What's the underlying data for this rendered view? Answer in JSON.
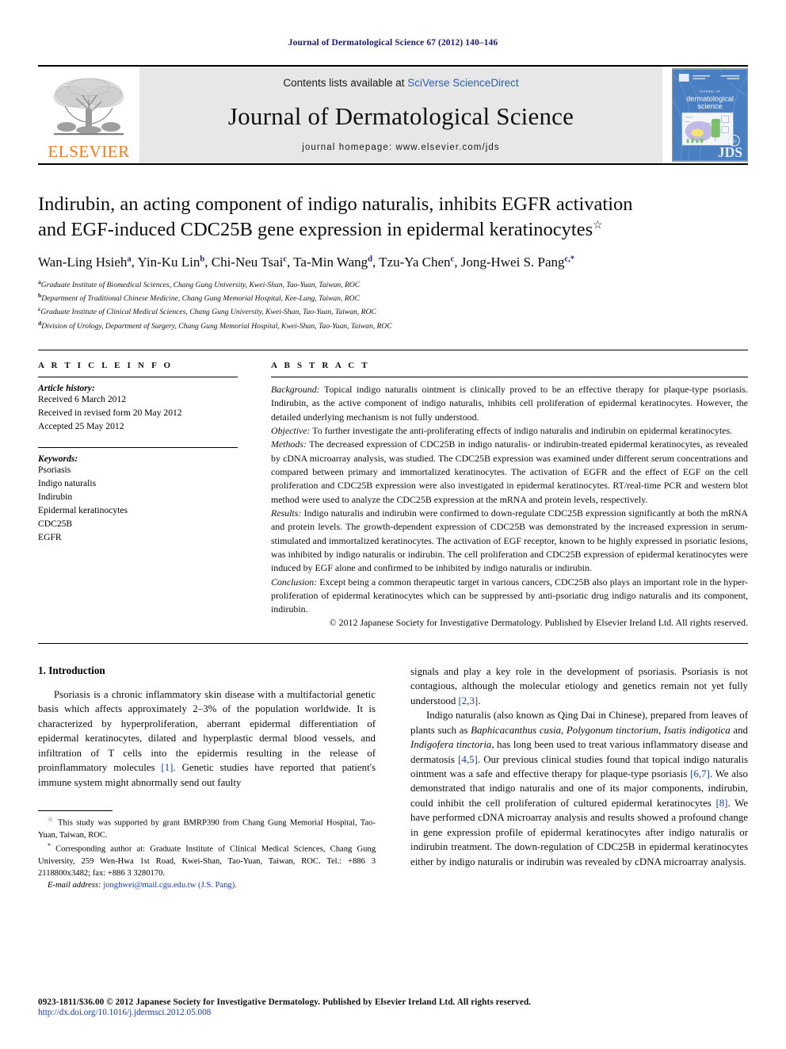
{
  "running_head": "Journal of Dermatological Science 67 (2012) 140–146",
  "masthead": {
    "publisher_name": "ELSEVIER",
    "contents_prefix": "Contents lists available at ",
    "contents_link": "SciVerse ScienceDirect",
    "journal_name": "Journal of Dermatological Science",
    "homepage": "journal homepage: www.elsevier.com/jds",
    "cover_title_small": "JOURNAL OF",
    "cover_title_1": "dermatological",
    "cover_title_2": "science",
    "cover_logo": "JDS",
    "accent_orange": "#F47B20",
    "link_blue": "#2b5fb5",
    "cover_blue": "#4a7fc1"
  },
  "title": {
    "line1": "Indirubin, an acting component of indigo naturalis, inhibits EGFR activation",
    "line2": "and EGF-induced CDC25B gene expression in epidermal keratinocytes",
    "title_marker": "☆"
  },
  "authors": [
    {
      "name": "Wan-Ling Hsieh",
      "sup": "a"
    },
    {
      "name": "Yin-Ku Lin",
      "sup": "b"
    },
    {
      "name": "Chi-Neu Tsai",
      "sup": "c"
    },
    {
      "name": "Ta-Min Wang",
      "sup": "d"
    },
    {
      "name": "Tzu-Ya Chen",
      "sup": "c"
    },
    {
      "name": "Jong-Hwei S. Pang",
      "sup": "c,*"
    }
  ],
  "affiliations": [
    {
      "marker": "a",
      "text": "Graduate Institute of Biomedical Sciences, Chang Gung University, Kwei-Shan, Tao-Yuan, Taiwan, ROC"
    },
    {
      "marker": "b",
      "text": "Department of Traditional Chinese Medicine, Chang Gung Memorial Hospital, Kee-Lung, Taiwan, ROC"
    },
    {
      "marker": "c",
      "text": "Graduate Institute of Clinical Medical Sciences, Chang Gung University, Kwei-Shan, Tao-Yuan, Taiwan, ROC"
    },
    {
      "marker": "d",
      "text": "Division of Urology, Department of Surgery, Chang Gung Memorial Hospital, Kwei-Shan, Tao-Yuan, Taiwan, ROC"
    }
  ],
  "article_info": {
    "heading": "A R T I C L E  I N F O",
    "history_label": "Article history:",
    "history": [
      "Received 6 March 2012",
      "Received in revised form 20 May 2012",
      "Accepted 25 May 2012"
    ],
    "keywords_label": "Keywords:",
    "keywords": [
      "Psoriasis",
      "Indigo naturalis",
      "Indirubin",
      "Epidermal keratinocytes",
      "CDC25B",
      "EGFR"
    ]
  },
  "abstract": {
    "heading": "A B S T R A C T",
    "sections": [
      {
        "label": "Background:",
        "text": " Topical indigo naturalis ointment is clinically proved to be an effective therapy for plaque-type psoriasis. Indirubin, as the active component of indigo naturalis, inhibits cell proliferation of epidermal keratinocytes. However, the detailed underlying mechanism is not fully understood."
      },
      {
        "label": "Objective:",
        "text": " To further investigate the anti-proliferating effects of indigo naturalis and indirubin on epidermal keratinocytes."
      },
      {
        "label": "Methods:",
        "text": " The decreased expression of CDC25B in indigo naturalis- or indirubin-treated epidermal keratinocytes, as revealed by cDNA microarray analysis, was studied. The CDC25B expression was examined under different serum concentrations and compared between primary and immortalized keratinocytes. The activation of EGFR and the effect of EGF on the cell proliferation and CDC25B expression were also investigated in epidermal keratinocytes. RT/real-time PCR and western blot method were used to analyze the CDC25B expression at the mRNA and protein levels, respectively."
      },
      {
        "label": "Results:",
        "text": " Indigo naturalis and indirubin were confirmed to down-regulate CDC25B expression significantly at both the mRNA and protein levels. The growth-dependent expression of CDC25B was demonstrated by the increased expression in serum-stimulated and immortalized keratinocytes. The activation of EGF receptor, known to be highly expressed in psoriatic lesions, was inhibited by indigo naturalis or indirubin. The cell proliferation and CDC25B expression of epidermal keratinocytes were induced by EGF alone and confirmed to be inhibited by indigo naturalis or indirubin."
      },
      {
        "label": "Conclusion:",
        "text": " Except being a common therapeutic target in various cancers, CDC25B also plays an important role in the hyper-proliferation of epidermal keratinocytes which can be suppressed by anti-psoriatic drug indigo naturalis and its component, indirubin."
      }
    ],
    "copyright": "© 2012 Japanese Society for Investigative Dermatology. Published by Elsevier Ireland Ltd. All rights reserved."
  },
  "introduction": {
    "heading": "1. Introduction",
    "left_paragraph": "Psoriasis is a chronic inflammatory skin disease with a multifactorial genetic basis which affects approximately 2–3% of the population worldwide. It is characterized by hyperproliferation, aberrant epidermal differentiation of epidermal keratinocytes, dilated and hyperplastic dermal blood vessels, and infiltration of T cells into the epidermis resulting in the release of proinflammatory molecules [1]. Genetic studies have reported that patient's immune system might abnormally send out faulty",
    "right_paragraph_1": "signals and play a key role in the development of psoriasis. Psoriasis is not contagious, although the molecular etiology and genetics remain not yet fully understood [2,3].",
    "right_paragraph_2": "Indigo naturalis (also known as Qing Dai in Chinese), prepared from leaves of plants such as Baphicacanthus cusia, Polygonum tinctorium, Isatis indigotica and Indigofera tinctoria, has long been used to treat various inflammatory disease and dermatosis [4,5]. Our previous clinical studies found that topical indigo naturalis ointment was a safe and effective therapy for plaque-type psoriasis [6,7]. We also demonstrated that indigo naturalis and one of its major components, indirubin, could inhibit the cell proliferation of cultured epidermal keratinocytes [8]. We have performed cDNA microarray analysis and results showed a profound change in gene expression profile of epidermal keratinocytes after indigo naturalis or indirubin treatment. The down-regulation of CDC25B in epidermal keratinocytes either by indigo naturalis or indirubin was revealed by cDNA microarray analysis."
  },
  "footnotes": {
    "grant_marker": "☆",
    "grant": " This study was supported by grant BMRP390 from Chang Gung Memorial Hospital, Tao-Yuan, Taiwan, ROC.",
    "corresponding_marker": "*",
    "corresponding": " Corresponding author at: Graduate Institute of Clinical Medical Sciences, Chang Gung University, 259 Wen-Hwa 1st Road, Kwei-Shan, Tao-Yuan, Taiwan, ROC. Tel.: +886 3 2118800x3482; fax: +886 3 3280170.",
    "email_label": "E-mail address:",
    "email": "jonghwei@mail.cgu.edu.tw",
    "email_suffix": " (J.S. Pang)."
  },
  "bottom": {
    "issn_line": "0923-1811/$36.00 © 2012 Japanese Society for Investigative Dermatology. Published by Elsevier Ireland Ltd. All rights reserved.",
    "doi": "http://dx.doi.org/10.1016/j.jdermsci.2012.05.008"
  }
}
